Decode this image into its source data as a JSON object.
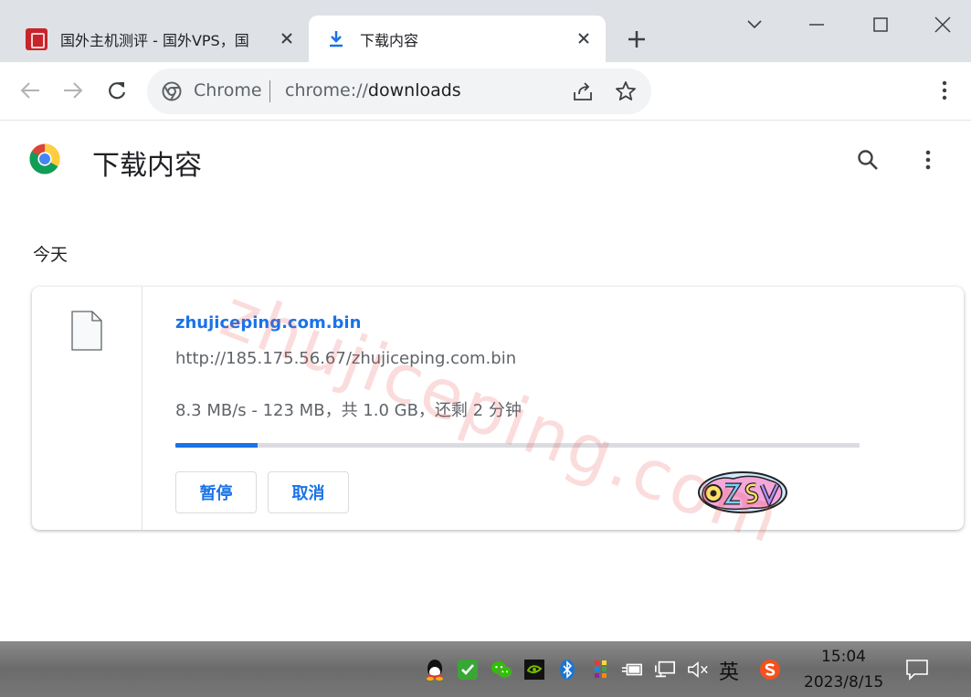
{
  "tabs": [
    {
      "title": "国外主机测评 - 国外VPS，国",
      "favicon": "site-favicon",
      "active": false
    },
    {
      "title": "下载内容",
      "favicon": "download-icon",
      "active": true
    }
  ],
  "omnibox": {
    "chip_label": "Chrome",
    "url_scheme": "chrome://",
    "url_host": "downloads"
  },
  "page": {
    "title": "下载内容",
    "section_date": "今天"
  },
  "watermark": "zhujiceping.com",
  "download": {
    "file_name": "zhujiceping.com.bin",
    "url": "http://185.175.56.67/zhujiceping.com.bin",
    "status": "8.3 MB/s - 123 MB，共 1.0 GB，还剩 2 分钟",
    "progress": 0.12,
    "pause_label": "暂停",
    "cancel_label": "取消"
  },
  "sticker_text": "OZSV",
  "taskbar": {
    "ime_label": "英",
    "time": "15:04",
    "date": "2023/8/15"
  },
  "colors": {
    "accent": "#1a73e8",
    "tabstrip": "#dee1e6",
    "omnibox": "#f1f3f4"
  }
}
